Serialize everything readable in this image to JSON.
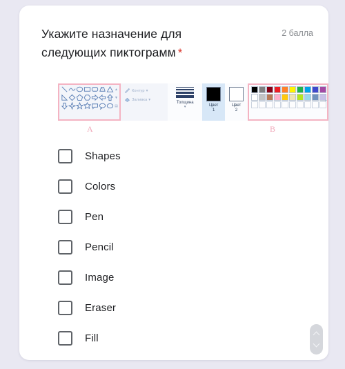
{
  "question": {
    "title_line1": "Укажите назначение для",
    "title_line2": "следующих пиктограмм",
    "required_marker": "*",
    "score": "2 балла"
  },
  "embedded_image": {
    "app": "paint-ribbon-toolbar",
    "annotations": [
      {
        "label": "A",
        "target": "shapes-gallery",
        "color": "#f0a9ba"
      },
      {
        "label": "B",
        "target": "color-palette",
        "color": "#f0a9ba"
      }
    ],
    "shapes_gallery": {
      "row1": [
        "line",
        "curve",
        "oval",
        "rectangle",
        "rounded-rectangle",
        "polygon",
        "triangle"
      ],
      "row2": [
        "right-triangle",
        "diamond",
        "pentagon",
        "hexagon",
        "right-arrow",
        "left-arrow",
        "up-arrow"
      ],
      "row3": [
        "down-arrow",
        "four-point-star",
        "five-point-star",
        "six-point-star",
        "rounded-callout",
        "oval-callout",
        "cloud-callout"
      ]
    },
    "outline_group": {
      "outline_label": "Контур",
      "fill_label": "Заливка",
      "dropdown_marker": "▾"
    },
    "thickness": {
      "label": "Толщина",
      "caret": "▾"
    },
    "color1": {
      "label": "Цвет",
      "index": "1",
      "swatch": "#000000",
      "selected": true
    },
    "color2": {
      "label": "Цвет",
      "index": "2",
      "swatch": "#ffffff",
      "selected": false
    },
    "palette": {
      "row1": [
        "#000000",
        "#7f7f7f",
        "#880015",
        "#ed1c24",
        "#ff7f27",
        "#fff200",
        "#22b14c",
        "#00a2e8",
        "#3f48cc",
        "#a349a4"
      ],
      "row2": [
        "#ffffff",
        "#c3c3c3",
        "#b97a57",
        "#ffaec9",
        "#ffc90e",
        "#efe4b0",
        "#b5e61d",
        "#99d9ea",
        "#7092be",
        "#c8bfe7"
      ],
      "row3_custom_empty_count": 10,
      "edit_colors_marker": "▸"
    }
  },
  "options": [
    {
      "label": "Shapes",
      "checked": false
    },
    {
      "label": "Colors",
      "checked": false
    },
    {
      "label": "Pen",
      "checked": false
    },
    {
      "label": "Pencil",
      "checked": false
    },
    {
      "label": "Image",
      "checked": false
    },
    {
      "label": "Eraser",
      "checked": false
    },
    {
      "label": "Fill",
      "checked": false
    }
  ],
  "scroll_control": {
    "up": "scroll-up",
    "down": "scroll-down"
  },
  "colors": {
    "page_background": "#e9e8f2",
    "card_background": "#ffffff",
    "text_primary": "#202124",
    "text_muted": "#8a8d91",
    "required_red": "#d93025",
    "annotation_pink": "#f0a9ba",
    "checkbox_border": "#5f6368"
  }
}
